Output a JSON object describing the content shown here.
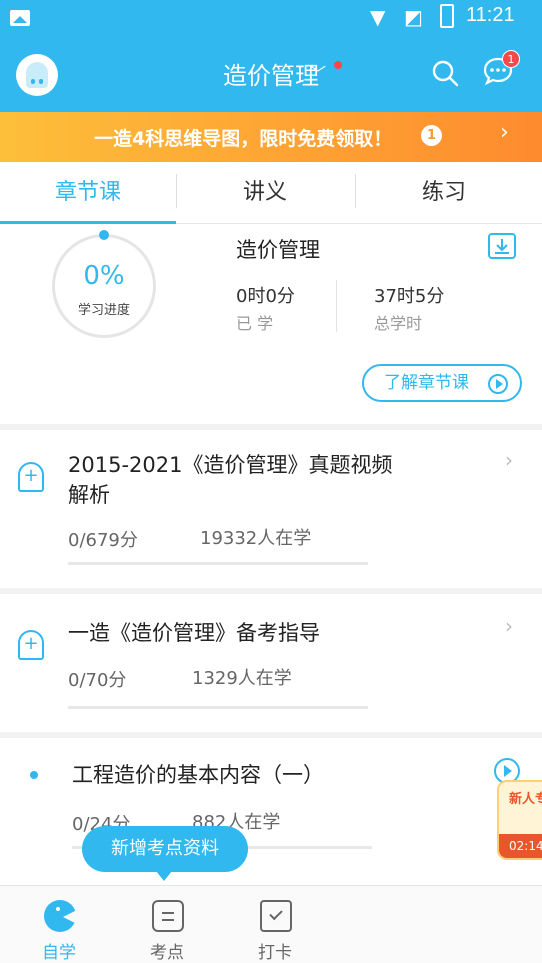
{
  "status_bar": {
    "time": "11:21"
  },
  "header": {
    "title": "造价管理",
    "chat_badge": "1"
  },
  "banner": {
    "text": "一造4科思维导图，限时免费领取！",
    "badge": "1"
  },
  "tabs": [
    {
      "label": "章节课",
      "active": true
    },
    {
      "label": "讲义",
      "active": false
    },
    {
      "label": "练习",
      "active": false
    }
  ],
  "progress": {
    "percent": "0%",
    "percent_label": "学习进度",
    "course_name": "造价管理",
    "learned_value": "0时0分",
    "learned_label": "已 学",
    "total_value": "37时5分",
    "total_label": "总学时",
    "learn_button": "了解章节课"
  },
  "list": [
    {
      "title": "2015-2021《造价管理》真题视频解析",
      "score": "0/679分",
      "learners": "19332人在学",
      "kind": "folder"
    },
    {
      "title": "一造《造价管理》备考指导",
      "score": "0/70分",
      "learners": "1329人在学",
      "kind": "folder"
    },
    {
      "title": "工程造价的基本内容（一）",
      "score": "0/24分",
      "learners": "882人在学",
      "kind": "video"
    }
  ],
  "promo": {
    "title": "新人专",
    "time": "02:14"
  },
  "tooltip": "新增考点资料",
  "bottom_nav": [
    {
      "label": "自学",
      "active": true
    },
    {
      "label": "考点",
      "active": false
    },
    {
      "label": "打卡",
      "active": false
    }
  ],
  "colors": {
    "accent": "#31b8ee",
    "banner_start": "#fdbf3a",
    "banner_end": "#fe8b2e",
    "alert": "#f24a4a"
  },
  "icons": [
    "image-icon",
    "wifi-icon",
    "no-sim-icon",
    "battery-icon",
    "avatar-ghost-icon",
    "chevron-down-icon",
    "search-icon",
    "chat-icon",
    "info-icon",
    "chevron-right-icon",
    "download-icon",
    "play-icon",
    "course-folder-icon",
    "self-study-icon",
    "notes-icon",
    "checkin-icon"
  ]
}
